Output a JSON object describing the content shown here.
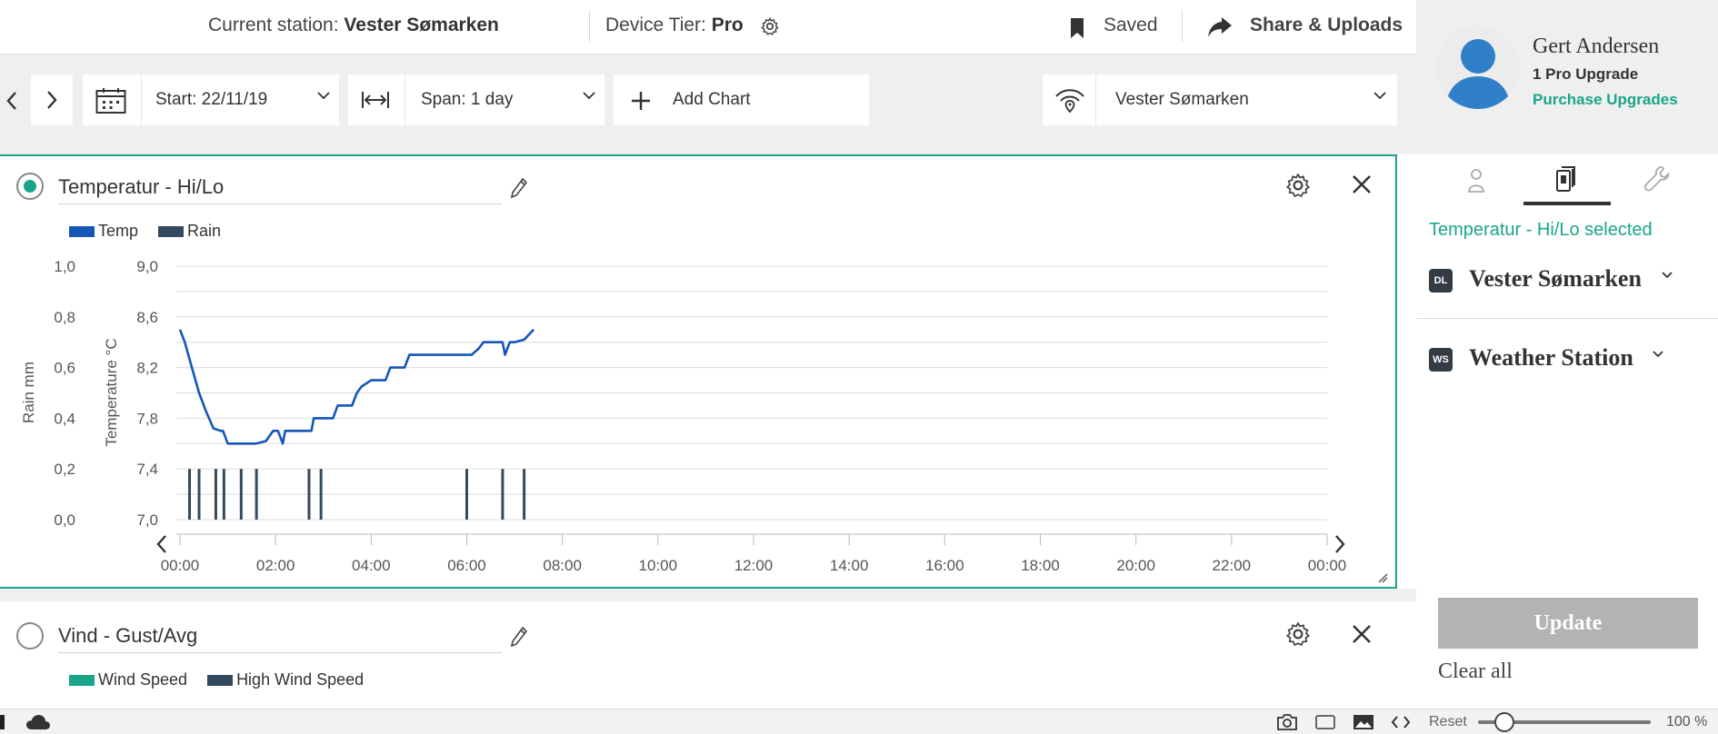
{
  "header": {
    "station_label": "Current station:",
    "station_name": "Vester Sømarken",
    "tier_label": "Device Tier:",
    "tier_value": "Pro",
    "saved_label": "Saved",
    "share_label": "Share & Uploads"
  },
  "toolbar": {
    "start_label": "Start: 22/11/19",
    "span_label": "Span: 1 day",
    "add_chart_label": "Add Chart",
    "station_select": "Vester Sømarken"
  },
  "charts": [
    {
      "title": "Temperatur - Hi/Lo",
      "selected": true,
      "legend": [
        {
          "name": "Temp",
          "color": "#1556b8"
        },
        {
          "name": "Rain",
          "color": "#34495e"
        }
      ]
    },
    {
      "title": "Vind - Gust/Avg",
      "selected": false,
      "legend": [
        {
          "name": "Wind Speed",
          "color": "#1aa58a"
        },
        {
          "name": "High Wind Speed",
          "color": "#34495e"
        }
      ]
    }
  ],
  "chart_data": {
    "type": "line",
    "ylabel_left": "Rain mm",
    "ylabel_right": "Temperature °C",
    "rain_ticks": [
      "1,0",
      "0,8",
      "0,6",
      "0,4",
      "0,2",
      "0,0"
    ],
    "temp_ticks": [
      "9,0",
      "8,6",
      "8,2",
      "7,8",
      "7,4",
      "7,0"
    ],
    "x_ticks": [
      "00:00",
      "02:00",
      "04:00",
      "06:00",
      "08:00",
      "10:00",
      "12:00",
      "14:00",
      "16:00",
      "18:00",
      "20:00",
      "22:00",
      "00:00"
    ],
    "ylim_temp": [
      7.0,
      9.0
    ],
    "ylim_rain": [
      0.0,
      1.0
    ],
    "xlim_hours": [
      0,
      24
    ],
    "grid": true,
    "legend_position": "top-left",
    "series": [
      {
        "name": "Temp",
        "x_hours": [
          0.0,
          0.1,
          0.25,
          0.4,
          0.55,
          0.7,
          0.85,
          0.9,
          1.0,
          1.2,
          1.6,
          1.8,
          1.95,
          2.05,
          2.15,
          2.2,
          2.6,
          2.75,
          2.8,
          3.1,
          3.2,
          3.3,
          3.6,
          3.7,
          3.8,
          4.0,
          4.3,
          4.4,
          4.5,
          4.7,
          4.8,
          4.9,
          5.5,
          6.1,
          6.25,
          6.35,
          6.5,
          6.7,
          6.75,
          6.8,
          6.9,
          7.0,
          7.2,
          7.4
        ],
        "values": [
          8.5,
          8.4,
          8.2,
          8.0,
          7.85,
          7.72,
          7.7,
          7.7,
          7.6,
          7.6,
          7.6,
          7.62,
          7.7,
          7.7,
          7.6,
          7.7,
          7.7,
          7.7,
          7.8,
          7.8,
          7.8,
          7.9,
          7.9,
          8.0,
          8.05,
          8.1,
          8.1,
          8.2,
          8.2,
          8.2,
          8.3,
          8.3,
          8.3,
          8.3,
          8.35,
          8.4,
          8.4,
          8.4,
          8.4,
          8.3,
          8.4,
          8.4,
          8.42,
          8.5
        ]
      },
      {
        "name": "Rain",
        "x_hours": [
          0.2,
          0.4,
          0.75,
          0.92,
          1.28,
          1.6,
          2.7,
          2.95,
          6.0,
          6.75,
          7.2
        ],
        "values": [
          0.2,
          0.2,
          0.2,
          0.2,
          0.2,
          0.2,
          0.2,
          0.2,
          0.2,
          0.2,
          0.2
        ]
      }
    ]
  },
  "sidebar": {
    "user_name": "Gert Andersen",
    "upgrades": "1 Pro Upgrade",
    "purchase": "Purchase Upgrades",
    "selected_text": "Temperatur - Hi/Lo selected",
    "tree": [
      {
        "badge": "DL",
        "label": "Vester Sømarken"
      },
      {
        "badge": "WS",
        "label": "Weather Station"
      }
    ],
    "update_label": "Update",
    "clear_label": "Clear all"
  },
  "statusbar": {
    "reset_label": "Reset",
    "zoom_value": "100 %",
    "zoom_fraction": 0.15
  }
}
